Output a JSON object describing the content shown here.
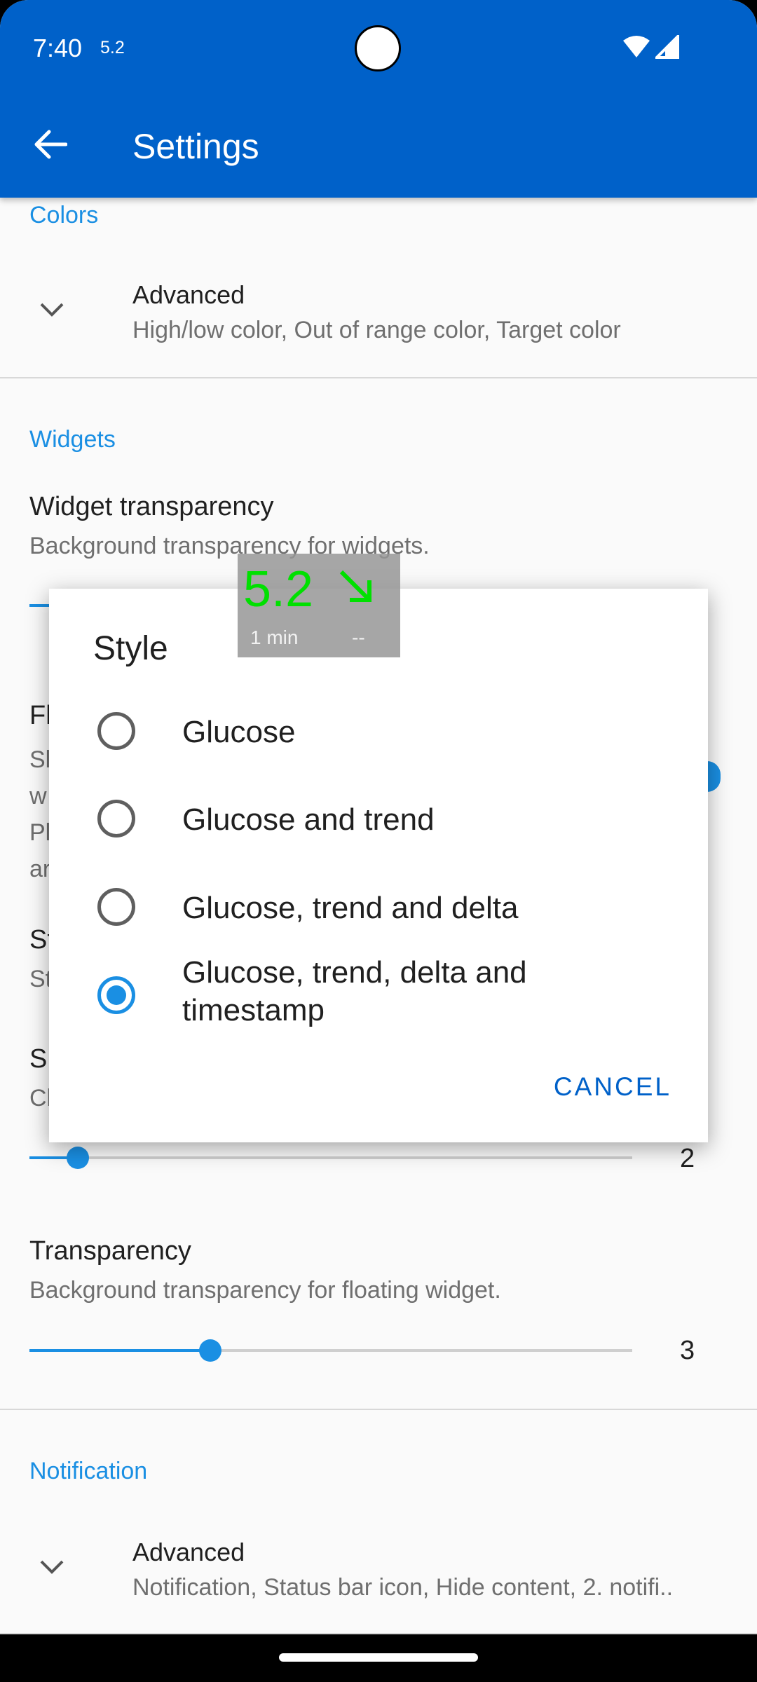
{
  "status_bar": {
    "time": "7:40",
    "glucose": "5.2"
  },
  "app_bar": {
    "title": "Settings"
  },
  "colors_section": {
    "header": "Colors",
    "advanced_title": "Advanced",
    "advanced_summary": "High/low color, Out of range color, Target color"
  },
  "widgets_section": {
    "header": "Widgets",
    "transparency_title": "Widget transparency",
    "transparency_summary": "Background transparency for widgets."
  },
  "size_slider": {
    "value": "2",
    "fraction": 0.08
  },
  "floating_transparency": {
    "title": "Transparency",
    "summary": "Background transparency for floating widget.",
    "value": "3",
    "fraction": 0.3
  },
  "notification_section": {
    "header": "Notification",
    "advanced_title": "Advanced",
    "advanced_summary": "Notification, Status bar icon, Hide content, 2. notifi.."
  },
  "dialog": {
    "title": "Style",
    "options": [
      {
        "label": "Glucose",
        "checked": false
      },
      {
        "label": "Glucose and trend",
        "checked": false
      },
      {
        "label": "Glucose, trend and delta",
        "checked": false
      },
      {
        "label": "Glucose, trend, delta and timestamp",
        "checked": true
      }
    ],
    "cancel_label": "CANCEL"
  },
  "widget_preview": {
    "value": "5.2",
    "time": "1 min",
    "delta": "--"
  },
  "colors": {
    "primary": "#0061c9",
    "accent": "#1a8fe3",
    "glucose_text": "#00e000"
  },
  "icons": [
    "back-arrow-icon",
    "wifi-icon",
    "signal-icon",
    "chevron-down-icon",
    "trend-down-right-icon"
  ]
}
